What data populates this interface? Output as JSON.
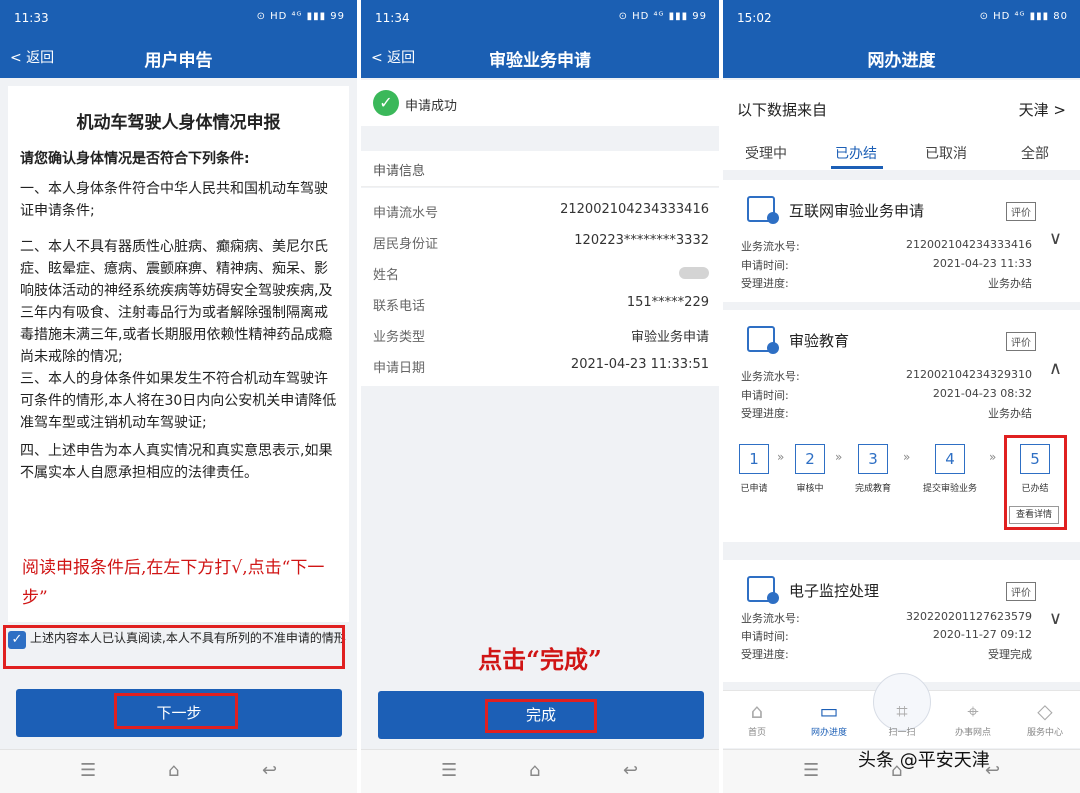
{
  "s1": {
    "time": "11:33",
    "status_icons": "⊙ HD ⁴ᴳ ▮▮▮ 99",
    "back": "< 返回",
    "title": "用户申告",
    "doc_title": "机动车驾驶人身体情况申报",
    "confirm_label": "请您确认身体情况是否符合下列条件:",
    "paragraphs": [
      "一、本人身体条件符合中华人民共和国机动车驾驶证申请条件;",
      "二、本人不具有器质性心脏病、癫痫病、美尼尔氏症、眩晕症、癔病、震颤麻痹、精神病、痴呆、影响肢体活动的神经系统疾病等妨碍安全驾驶疾病,及三年内有吸食、注射毒品行为或者解除强制隔离戒毒措施未满三年,或者长期服用依赖性精神药品成瘾尚未戒除的情况;",
      "三、本人的身体条件如果发生不符合机动车驾驶许可条件的情形,本人将在30日内向公安机关申请降低准驾车型或注销机动车驾驶证;",
      "四、上述申告为本人真实情况和真实意思表示,如果不属实本人自愿承担相应的法律责任。"
    ],
    "hint": "阅读申报条件后,在左下方打√,点击“下一步”",
    "check_mark": "✓",
    "checkbox_text": "上述内容本人已认真阅读,本人不具有所列的不准申请的情形",
    "next_button": "下一步"
  },
  "s2": {
    "time": "11:34",
    "status_icons": "⊙ HD ⁴ᴳ ▮▮▮ 99",
    "back": "< 返回",
    "title": "审验业务申请",
    "success_icon": "✓",
    "success_text": "申请成功",
    "info_header": "申请信息",
    "rows": [
      {
        "k": "申请流水号",
        "v": "212002104234333416"
      },
      {
        "k": "居民身份证",
        "v": "120223********3332"
      },
      {
        "k": "姓名",
        "v": ""
      },
      {
        "k": "联系电话",
        "v": "151*****229"
      },
      {
        "k": "业务类型",
        "v": "审验业务申请"
      },
      {
        "k": "申请日期",
        "v": "2021-04-23 11:33:51"
      }
    ],
    "hint": "点击“完成”",
    "done_button": "完成"
  },
  "s3": {
    "time": "15:02",
    "status_icons": "⊙ HD ⁴ᴳ ▮▮▮ 80",
    "title": "网办进度",
    "source_label": "以下数据来自",
    "city": "天津 >",
    "tabs": [
      "受理中",
      "已办结",
      "已取消",
      "全部"
    ],
    "cards": [
      {
        "name": "互联网审验业务申请",
        "rate": "评价",
        "chev": "∨",
        "serial_k": "业务流水号:",
        "serial": "212002104234333416",
        "time_k": "申请时间:",
        "time": "2021-04-23 11:33",
        "prog_k": "受理进度:",
        "prog": "业务办结"
      },
      {
        "name": "审验教育",
        "rate": "评价",
        "chev": "∧",
        "serial_k": "业务流水号:",
        "serial": "212002104234329310",
        "time_k": "申请时间:",
        "time": "2021-04-23 08:32",
        "prog_k": "受理进度:",
        "prog": "业务办结"
      },
      {
        "name": "电子监控处理",
        "rate": "评价",
        "chev": "∨",
        "serial_k": "业务流水号:",
        "serial": "320220201127623579",
        "time_k": "申请时间:",
        "time": "2020-11-27 09:12",
        "prog_k": "受理进度:",
        "prog": "受理完成"
      }
    ],
    "steps": [
      {
        "n": "1",
        "label": "已申请"
      },
      {
        "n": "2",
        "label": "审核中"
      },
      {
        "n": "3",
        "label": "完成教育"
      },
      {
        "n": "4",
        "label": "提交审验业务"
      },
      {
        "n": "5",
        "label": "已办结"
      }
    ],
    "step_arrow": "»",
    "detail_button": "查看详情",
    "tabbar": [
      {
        "label": "首页",
        "icon": "⌂"
      },
      {
        "label": "网办进度",
        "icon": "▭"
      },
      {
        "label": "扫一扫",
        "icon": "⌗"
      },
      {
        "label": "办事网点",
        "icon": "⌖"
      },
      {
        "label": "服务中心",
        "icon": "◇"
      }
    ]
  },
  "nav_icons": {
    "menu": "☰",
    "home": "⌂",
    "back": "↩"
  },
  "watermark": "头条 @平安天津"
}
